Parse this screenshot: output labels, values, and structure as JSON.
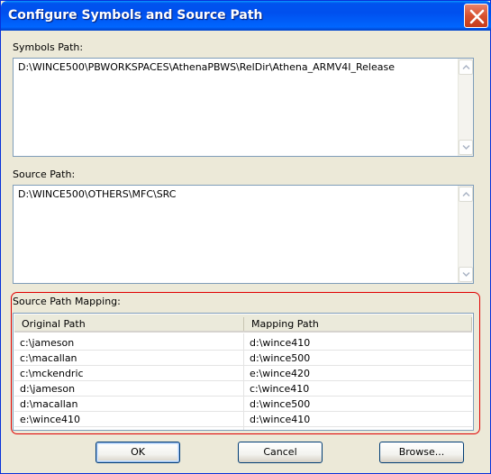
{
  "window": {
    "title": "Configure Symbols and Source Path",
    "titlebar_color": "#0054e3",
    "close_button_color": "#d8512f"
  },
  "symbols": {
    "label": "Symbols Path:",
    "value": "D:\\WINCE500\\PBWORKSPACES\\AthenaPBWS\\RelDir\\Athena_ARMV4I_Release"
  },
  "source": {
    "label": "Source Path:",
    "value": "D:\\WINCE500\\OTHERS\\MFC\\SRC"
  },
  "mapping": {
    "label": "Source Path Mapping:",
    "highlight_color": "#e00000",
    "columns": [
      "Original Path",
      "Mapping Path"
    ],
    "rows": [
      {
        "original": "c:\\jameson",
        "mapping": "d:\\wince410"
      },
      {
        "original": "c:\\macallan",
        "mapping": "d:\\wince500"
      },
      {
        "original": "c:\\mckendric",
        "mapping": "e:\\wince420"
      },
      {
        "original": "d:\\jameson",
        "mapping": "c:\\wince410"
      },
      {
        "original": "d:\\macallan",
        "mapping": "d:\\wince500"
      },
      {
        "original": "e:\\wince410",
        "mapping": "d:\\wince410"
      }
    ]
  },
  "buttons": {
    "ok": "OK",
    "cancel": "Cancel",
    "browse": "Browse..."
  }
}
